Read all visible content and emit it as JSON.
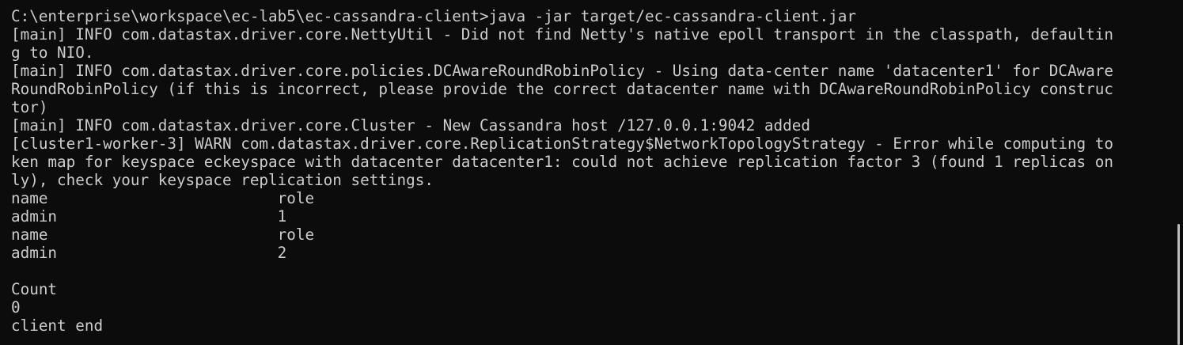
{
  "terminal": {
    "lines": [
      "C:\\enterprise\\workspace\\ec-lab5\\ec-cassandra-client>java -jar target/ec-cassandra-client.jar",
      "[main] INFO com.datastax.driver.core.NettyUtil - Did not find Netty's native epoll transport in the classpath, defaultin",
      "g to NIO.",
      "[main] INFO com.datastax.driver.core.policies.DCAwareRoundRobinPolicy - Using data-center name 'datacenter1' for DCAware",
      "RoundRobinPolicy (if this is incorrect, please provide the correct datacenter name with DCAwareRoundRobinPolicy construc",
      "tor)",
      "[main] INFO com.datastax.driver.core.Cluster - New Cassandra host /127.0.0.1:9042 added",
      "[cluster1-worker-3] WARN com.datastax.driver.core.ReplicationStrategy$NetworkTopologyStrategy - Error while computing to",
      "ken map for keyspace eckeyspace with datacenter datacenter1: could not achieve replication factor 3 (found 1 replicas on",
      "ly), check your keyspace replication settings.",
      "name                         role",
      "admin                        1",
      "name                         role",
      "admin                        2",
      "",
      "Count",
      "0",
      "client end"
    ]
  },
  "colors": {
    "background": "#0c0c0c",
    "text": "#cccccc",
    "scrollbar_thumb": "#bdbdbd"
  }
}
